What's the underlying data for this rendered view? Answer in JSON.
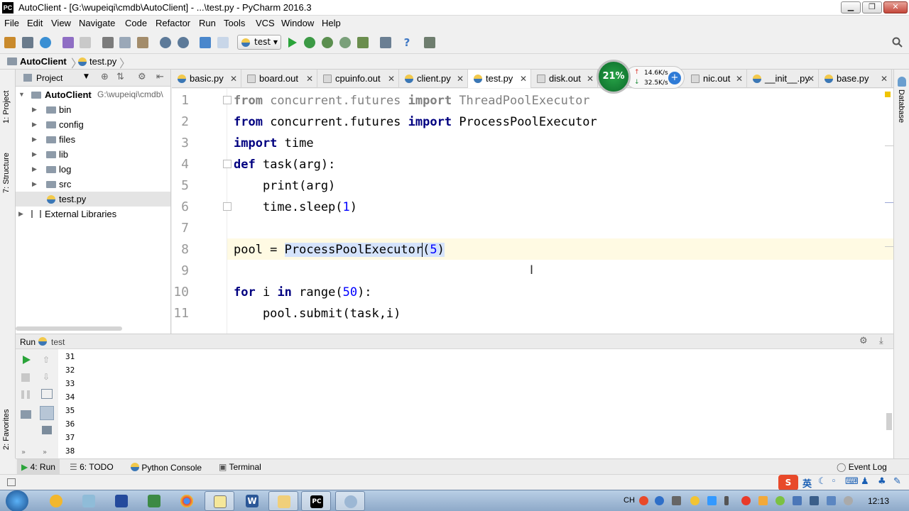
{
  "window": {
    "title": "AutoClient - [G:\\wupeiqi\\cmdb\\AutoClient] - ...\\test.py - PyCharm 2016.3",
    "app_logo": "PC"
  },
  "menu": [
    "File",
    "Edit",
    "View",
    "Navigate",
    "Code",
    "Refactor",
    "Run",
    "Tools",
    "VCS",
    "Window",
    "Help"
  ],
  "toolbar": {
    "run_config": "test"
  },
  "navbar": {
    "root": "AutoClient",
    "file": "test.py"
  },
  "left_stripe": {
    "project_tab": "1: Project",
    "structure_tab": "7: Structure",
    "favorites_tab": "2: Favorites"
  },
  "right_stripe": {
    "database_tab": "Database"
  },
  "project_panel": {
    "title": "Project",
    "root_name": "AutoClient",
    "root_path": "G:\\wupeiqi\\cmdb\\",
    "items": [
      {
        "name": "bin",
        "type": "folder"
      },
      {
        "name": "config",
        "type": "folder"
      },
      {
        "name": "files",
        "type": "folder"
      },
      {
        "name": "lib",
        "type": "folder"
      },
      {
        "name": "log",
        "type": "folder"
      },
      {
        "name": "src",
        "type": "folder"
      },
      {
        "name": "test.py",
        "type": "file"
      }
    ],
    "external": "External Libraries"
  },
  "tabs": [
    {
      "label": "basic.py",
      "type": "py"
    },
    {
      "label": "board.out",
      "type": "txt"
    },
    {
      "label": "cpuinfo.out",
      "type": "txt"
    },
    {
      "label": "client.py",
      "type": "py"
    },
    {
      "label": "test.py",
      "type": "py",
      "active": true
    },
    {
      "label": "disk.out",
      "type": "txt"
    },
    {
      "label": "nic.out",
      "type": "txt"
    },
    {
      "label": "__init__.py",
      "type": "py"
    },
    {
      "label": "base.py",
      "type": "py"
    }
  ],
  "speed_widget": {
    "percent": "21%",
    "up": "14.6K/s",
    "down": "32.5K/s"
  },
  "editor": {
    "line_numbers": [
      "1",
      "2",
      "3",
      "4",
      "5",
      "6",
      "7",
      "8",
      "9",
      "10",
      "11"
    ],
    "code": {
      "l1_kw1": "from",
      "l1_mod": " concurrent.futures ",
      "l1_kw2": "import",
      "l1_cls": " ThreadPoolExecutor",
      "l2_kw1": "from",
      "l2_mod": " concurrent.futures ",
      "l2_kw2": "import",
      "l2_cls": " ProcessPoolExecutor",
      "l3_kw": "import",
      "l3_mod": " time",
      "l4_kw": "def",
      "l4_rest": " task(arg):",
      "l5": "    print(arg)",
      "l6_a": "    time.sleep(",
      "l6_num": "1",
      "l6_b": ")",
      "l8_a": "pool = ",
      "l8_cls": "ProcessPoolExecutor",
      "l8_b": "(",
      "l8_num": "5",
      "l8_c": ")",
      "l10_kw1": "for",
      "l10_a": " i ",
      "l10_kw2": "in",
      "l10_b": " range(",
      "l10_num": "50",
      "l10_c": "):",
      "l11": "    pool.submit(task,i)"
    }
  },
  "run_panel": {
    "label": "Run",
    "config": "test",
    "output": [
      "31",
      "32",
      "33",
      "34",
      "35",
      "36",
      "37",
      "38"
    ]
  },
  "bottom_tabs": {
    "run": "4: Run",
    "todo": "6: TODO",
    "console": "Python Console",
    "terminal": "Terminal",
    "event_log": "Event Log"
  },
  "taskbar": {
    "clock": "12:13",
    "ime_lang": "CH",
    "ime_mode": "英"
  },
  "colors": {
    "keyword": "#000080",
    "number": "#0000ff",
    "current_line": "#fffae3",
    "selection": "#d5e3fb",
    "speed_circle": "#1b8a3a"
  }
}
